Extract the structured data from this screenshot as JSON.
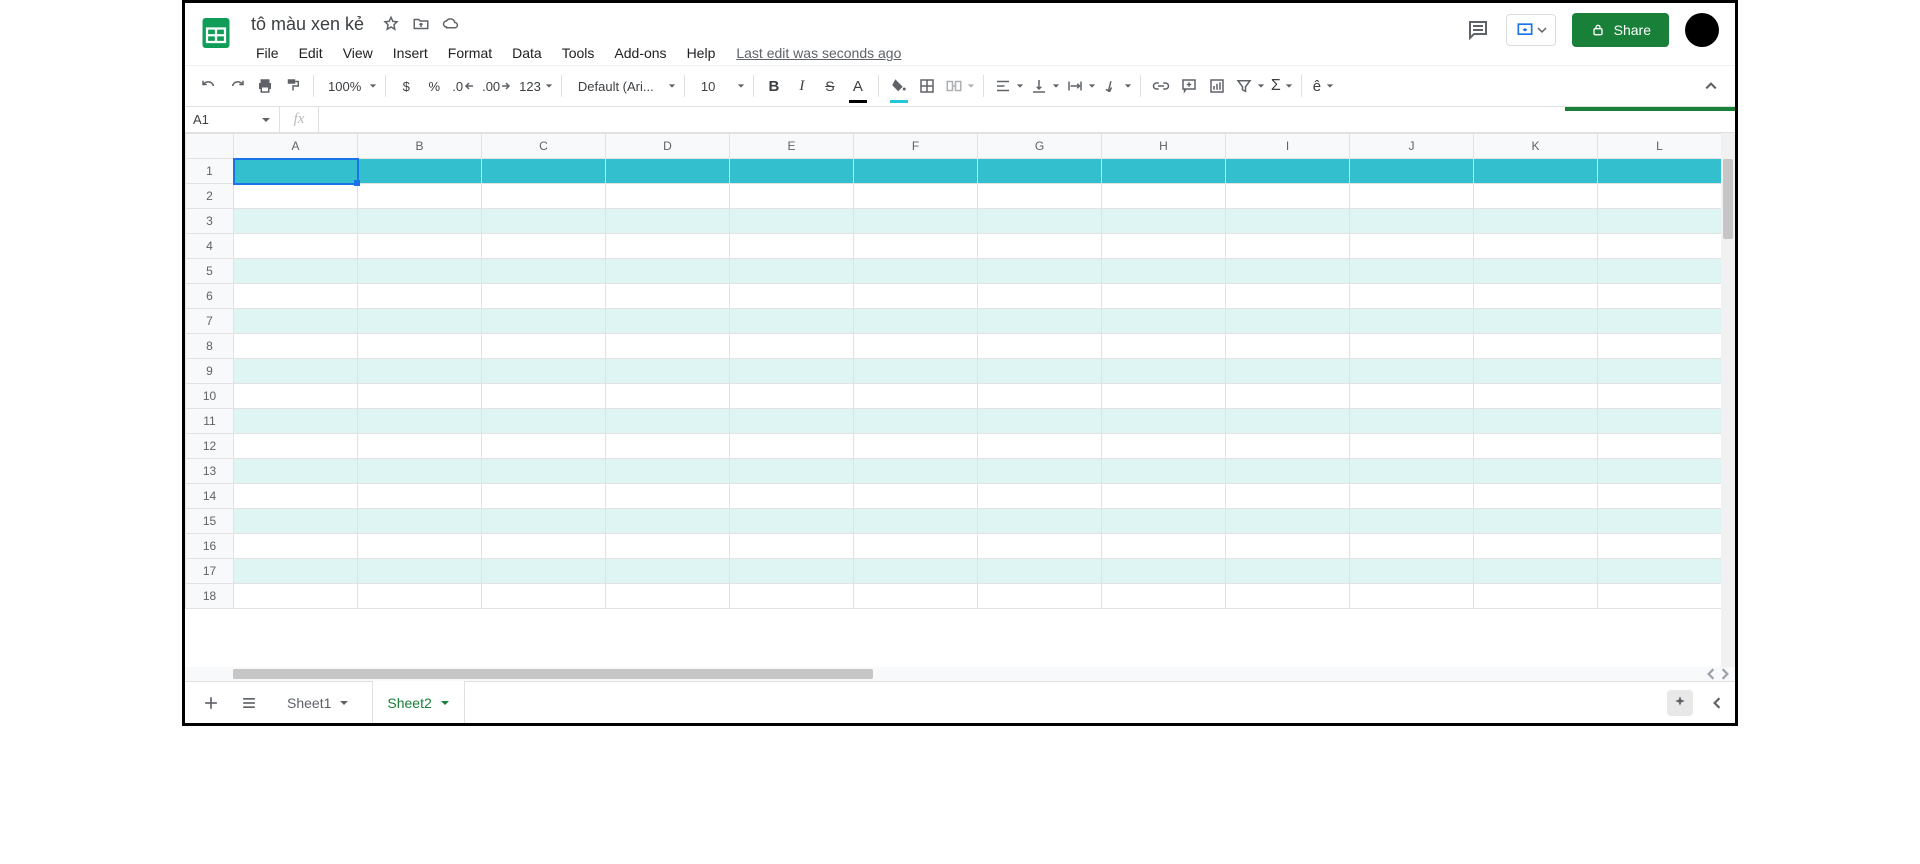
{
  "header": {
    "doc_title": "tô màu xen kẻ",
    "menus": [
      "File",
      "Edit",
      "View",
      "Insert",
      "Format",
      "Data",
      "Tools",
      "Add-ons",
      "Help"
    ],
    "last_edit": "Last edit was seconds ago",
    "share_label": "Share"
  },
  "toolbar": {
    "zoom": "100%",
    "currency": "$",
    "percent": "%",
    "dec_dec": ".0",
    "inc_dec": ".00",
    "num_fmt": "123",
    "font": "Default (Ari...",
    "font_size": "10",
    "text_color_underline": "#000000",
    "fill_color_underline": "#26c6da"
  },
  "namebox": {
    "value": "A1"
  },
  "grid": {
    "columns": [
      "A",
      "B",
      "C",
      "D",
      "E",
      "F",
      "G",
      "H",
      "I",
      "J",
      "K",
      "L"
    ],
    "rows": [
      1,
      2,
      3,
      4,
      5,
      6,
      7,
      8,
      9,
      10,
      11,
      12,
      13,
      14,
      15,
      16,
      17,
      18
    ],
    "active_cell": "A1",
    "alt_color": "#dff5f3",
    "header_row_color": "#34bfcf"
  },
  "tabs": {
    "sheets": [
      "Sheet1",
      "Sheet2"
    ],
    "active": "Sheet2"
  }
}
